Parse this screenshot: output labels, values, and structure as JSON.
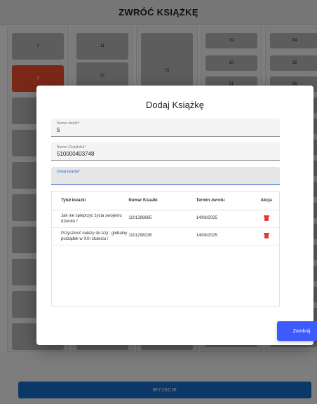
{
  "app": {
    "title": "ZWRÓĆ KSIĄŻKĘ",
    "exit_label": "WYJSCIE",
    "lockers": [
      {
        "num": "1"
      },
      {
        "num": "2"
      },
      {
        "num": "11"
      },
      {
        "num": "12"
      },
      {
        "num": "15"
      },
      {
        "num": "19"
      },
      {
        "num": "20"
      },
      {
        "num": "21"
      },
      {
        "num": "34"
      },
      {
        "num": "35"
      },
      {
        "num": "36"
      }
    ],
    "colors": {
      "selected_locker": "#e24a2c",
      "exit_button": "#1565c0"
    }
  },
  "modal": {
    "title": "Dodaj Książkę",
    "fields": {
      "locker": {
        "label": "Numer skrytki*",
        "value": "5"
      },
      "reader": {
        "label": "Numer Czytelnika*",
        "value": "510000403748"
      },
      "book": {
        "label": "Dodaj książkę*",
        "value": ""
      }
    },
    "table": {
      "headers": [
        "Tytuł ksiazki",
        "Numar Ksiazki",
        "Termin zwrotu",
        "Akcja"
      ],
      "rows": [
        {
          "title": "Jak nie spieprzyć życia swojemu dziecku /",
          "number": "1101289665",
          "due": "14/08/2025",
          "action_icon": "trash-icon"
        },
        {
          "title": "Przyszłość należy do Azji : globalny porządek w XXI stuleciu /",
          "number": "1101298136",
          "due": "14/08/2025",
          "action_icon": "trash-icon"
        }
      ]
    },
    "close_label": "Zamknij",
    "colors": {
      "close_button": "#3d5afe",
      "delete_icon": "#e53935",
      "active_field": "#2f5fd6"
    }
  }
}
